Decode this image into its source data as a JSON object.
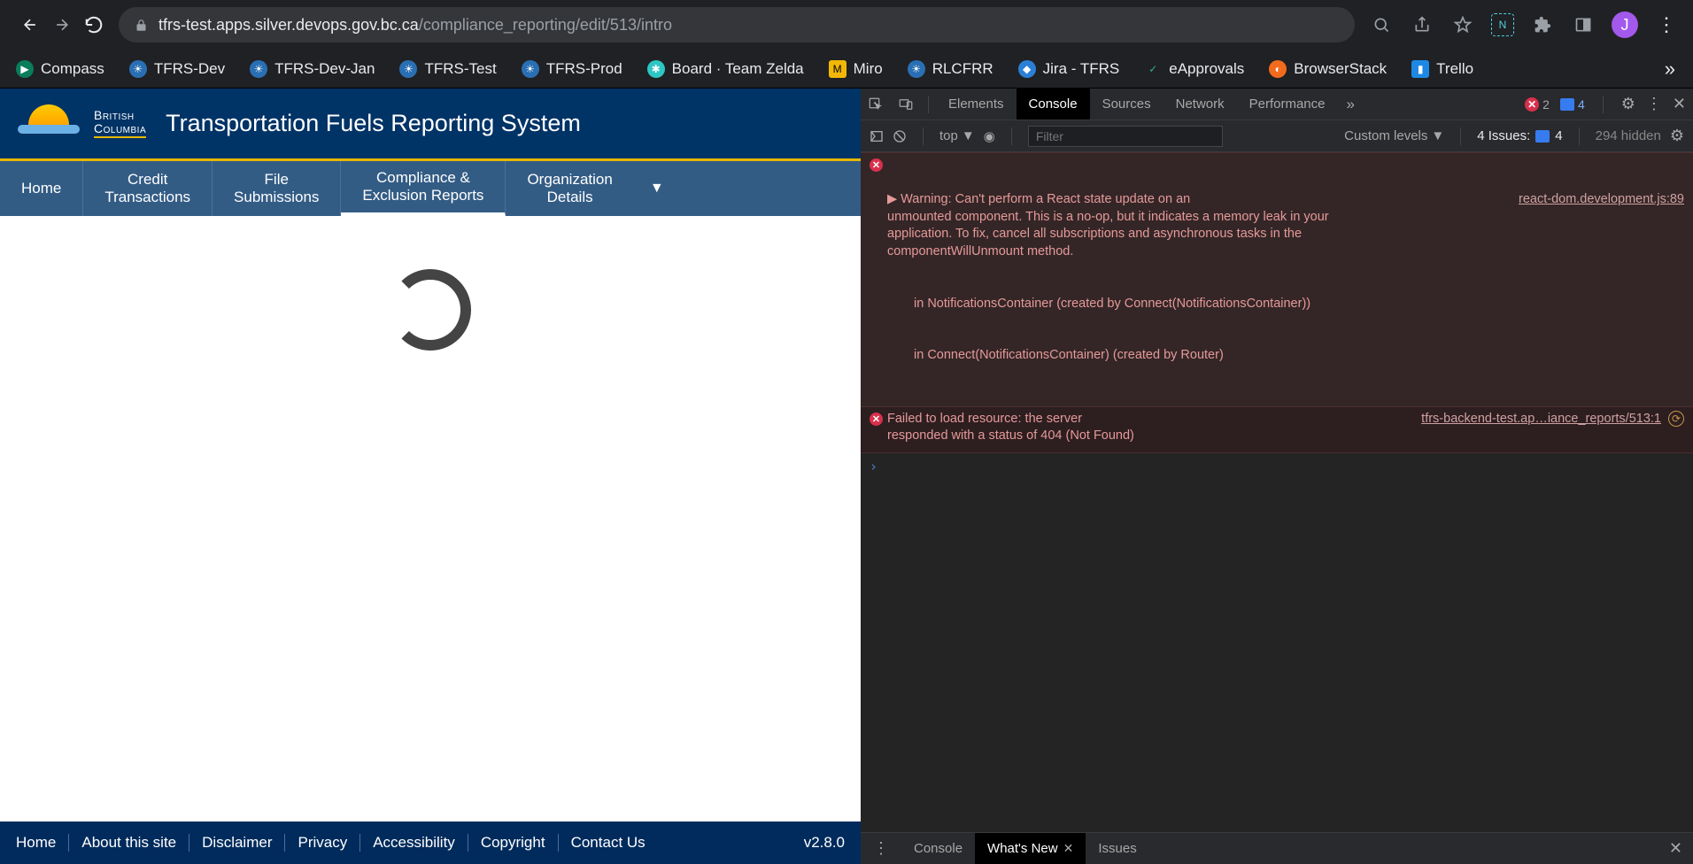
{
  "browser": {
    "url_host": "tfrs-test.apps.silver.devops.gov.bc.ca",
    "url_path": "/compliance_reporting/edit/513/intro",
    "avatar_initial": "J"
  },
  "bookmarks": [
    {
      "label": "Compass",
      "color": "#0a7d5a"
    },
    {
      "label": "TFRS-Dev",
      "color": "#2a6fb3"
    },
    {
      "label": "TFRS-Dev-Jan",
      "color": "#2a6fb3"
    },
    {
      "label": "TFRS-Test",
      "color": "#2a6fb3"
    },
    {
      "label": "TFRS-Prod",
      "color": "#2a6fb3"
    },
    {
      "label": "Board · Team Zelda",
      "color": "#2dc7c4"
    },
    {
      "label": "Miro",
      "color": "#f2b705"
    },
    {
      "label": "RLCFRR",
      "color": "#2a6fb3"
    },
    {
      "label": "Jira - TFRS",
      "color": "#2a80d6"
    },
    {
      "label": "eApprovals",
      "color": "#2fb27f"
    },
    {
      "label": "BrowserStack",
      "color": "#f26b1d"
    },
    {
      "label": "Trello",
      "color": "#1e88e5"
    }
  ],
  "app": {
    "logo_top": "British",
    "logo_bot": "Columbia",
    "title": "Transportation Fuels Reporting System",
    "nav": {
      "home": "Home",
      "credit": "Credit\nTransactions",
      "file": "File\nSubmissions",
      "compliance": "Compliance &\nExclusion Reports",
      "org": "Organization\nDetails"
    },
    "footer": {
      "home": "Home",
      "about": "About this site",
      "disclaimer": "Disclaimer",
      "privacy": "Privacy",
      "accessibility": "Accessibility",
      "copyright": "Copyright",
      "contact": "Contact Us"
    },
    "version": "v2.8.0"
  },
  "devtools": {
    "tabs": {
      "elements": "Elements",
      "console": "Console",
      "sources": "Sources",
      "network": "Network",
      "performance": "Performance"
    },
    "error_count": "2",
    "msg_count": "4",
    "toolbar": {
      "context": "top",
      "filter_placeholder": "Filter",
      "levels": "Custom levels",
      "issues_label": "4 Issues:",
      "issues_count": "4",
      "hidden": "294 hidden"
    },
    "warn": {
      "text": "Warning: Can't perform a React state update on an\nunmounted component. This is a no-op, but it indicates a memory leak in your\napplication. To fix, cancel all subscriptions and asynchronous tasks in the\ncomponentWillUnmount method.",
      "stack1": "in NotificationsContainer (created by Connect(NotificationsContainer))",
      "stack2": "in Connect(NotificationsContainer) (created by Router)",
      "src": "react-dom.development.js:89"
    },
    "err": {
      "text": "Failed to load resource: the server\nresponded with a status of 404 (Not Found)",
      "src": "tfrs-backend-test.ap…iance_reports/513:1"
    },
    "drawer": {
      "console": "Console",
      "whatsnew": "What's New",
      "issues": "Issues"
    }
  }
}
